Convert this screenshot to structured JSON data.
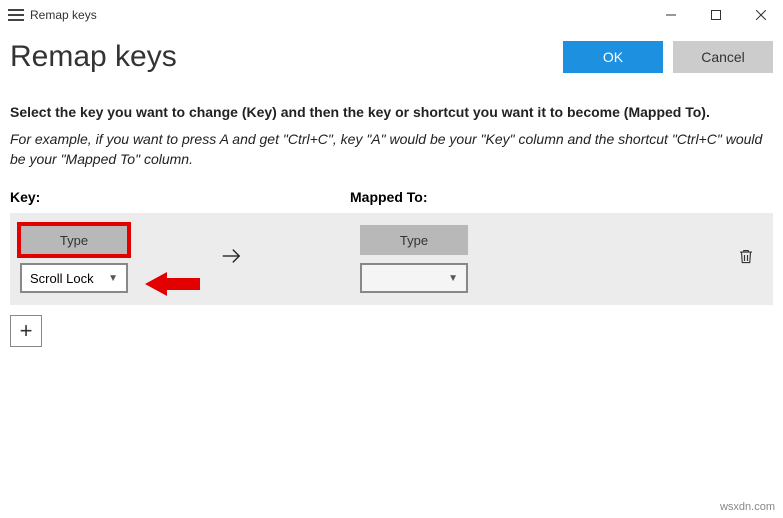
{
  "titlebar": {
    "title": "Remap keys"
  },
  "header": {
    "title": "Remap keys",
    "ok_label": "OK",
    "cancel_label": "Cancel"
  },
  "instruction": "Select the key you want to change (Key) and then the key or shortcut you want it to become (Mapped To).",
  "example": "For example, if you want to press A and get \"Ctrl+C\", key \"A\" would be your \"Key\" column and the shortcut \"Ctrl+C\" would be your \"Mapped To\" column.",
  "columns": {
    "key_label": "Key:",
    "mapped_label": "Mapped To:"
  },
  "row": {
    "key_type_label": "Type",
    "key_selected": "Scroll Lock",
    "mapped_type_label": "Type",
    "mapped_selected": ""
  },
  "add_label": "+",
  "watermark": "wsxdn.com"
}
